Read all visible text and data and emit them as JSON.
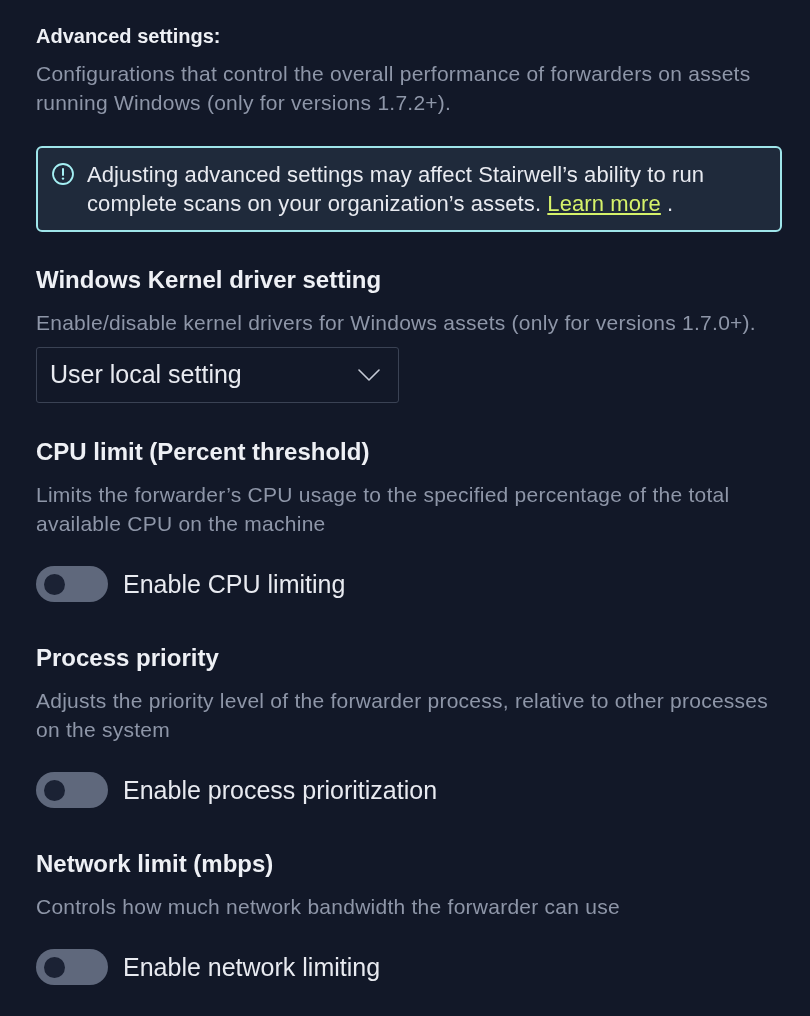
{
  "advanced_settings": {
    "title": "Advanced settings:",
    "description": "Configurations that control the overall performance of forwarders on assets running Windows (only for versions 1.7.2+)."
  },
  "alert": {
    "text": "Adjusting advanced settings may affect Stairwell’s ability to run complete scans on your organization’s assets. ",
    "link": "Learn more",
    "after": " ."
  },
  "sections": [
    {
      "kind": "select",
      "title": "Windows Kernel driver setting",
      "description": "Enable/disable kernel drivers for Windows assets (only for versions 1.7.0+).",
      "value": "User local setting"
    },
    {
      "kind": "toggle",
      "title": "CPU limit (Percent threshold)",
      "description": "Limits the forwarder’s CPU usage to the specified percentage of the total available CPU on the machine",
      "label": "Enable CPU limiting",
      "on": false
    },
    {
      "kind": "toggle",
      "title": "Process priority",
      "description": "Adjusts the priority level of the forwarder process, relative to other processes on the system",
      "label": "Enable process prioritization",
      "on": false
    },
    {
      "kind": "toggle",
      "title": "Network limit (mbps)",
      "description": "Controls how much network bandwidth the forwarder can use",
      "label": "Enable network limiting",
      "on": false
    }
  ]
}
